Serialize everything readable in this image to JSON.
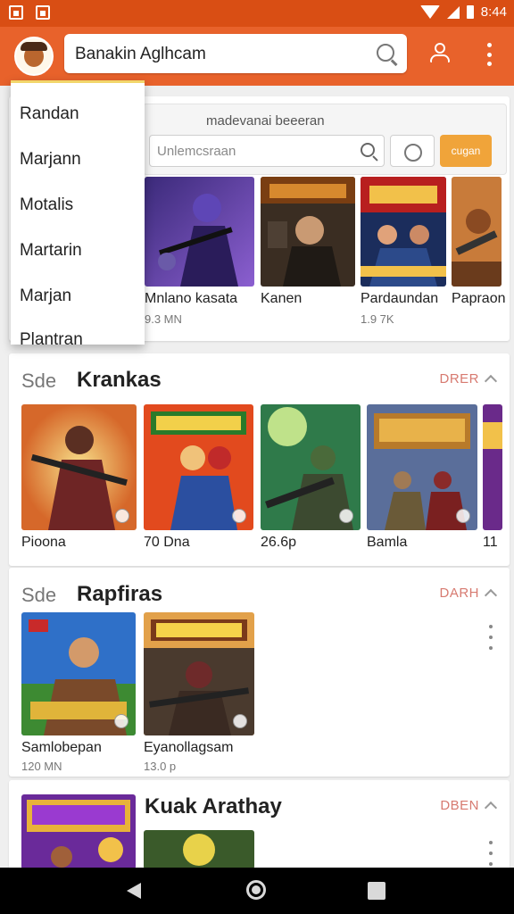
{
  "status_bar": {
    "time": "8:44"
  },
  "app_bar": {
    "search_text": "Banakin Aglhcam"
  },
  "dropdown": {
    "items": [
      "Randan",
      "Marjann",
      "Motalis",
      "Martarin",
      "Marjan",
      "Plantran"
    ]
  },
  "top_section": {
    "search_panel_title": "madevanai beeeran",
    "search_placeholder": "Unlemcsraan",
    "button_label": "cugan",
    "tiles": [
      {
        "title": "Mnlano kasata",
        "sub": "9.3 MN"
      },
      {
        "title": "Kanen",
        "sub": ""
      },
      {
        "title": "Pardaundan",
        "sub": "1.9 7K"
      },
      {
        "title": "Papraon",
        "sub": ""
      }
    ]
  },
  "section_krankas": {
    "prefix": "Sde",
    "title": "Krankas",
    "toggle": "DRER",
    "tiles": [
      {
        "title": "Pioona"
      },
      {
        "title": "70 Dna"
      },
      {
        "title": "26.6p"
      },
      {
        "title": "Bamla"
      },
      {
        "title": "11"
      }
    ]
  },
  "section_rapfiras": {
    "prefix": "Sde",
    "title": "Rapfiras",
    "toggle": "DARH",
    "tiles": [
      {
        "title": "Samlobepan",
        "sub": "120 MN"
      },
      {
        "title": "Eyanollagsam",
        "sub": "13.0 p"
      }
    ]
  },
  "section_kuak": {
    "title": "Kuak Arathay",
    "toggle": "DBEN"
  },
  "colors": {
    "status_bar": "#d94e14",
    "app_bar": "#e8622b",
    "accent_button": "#f0a43a",
    "toggle_text": "#d77a70"
  },
  "icons": [
    "search-icon",
    "account-icon",
    "more-vert-icon",
    "back-icon",
    "home-icon",
    "recents-icon",
    "chevron-up-icon"
  ]
}
